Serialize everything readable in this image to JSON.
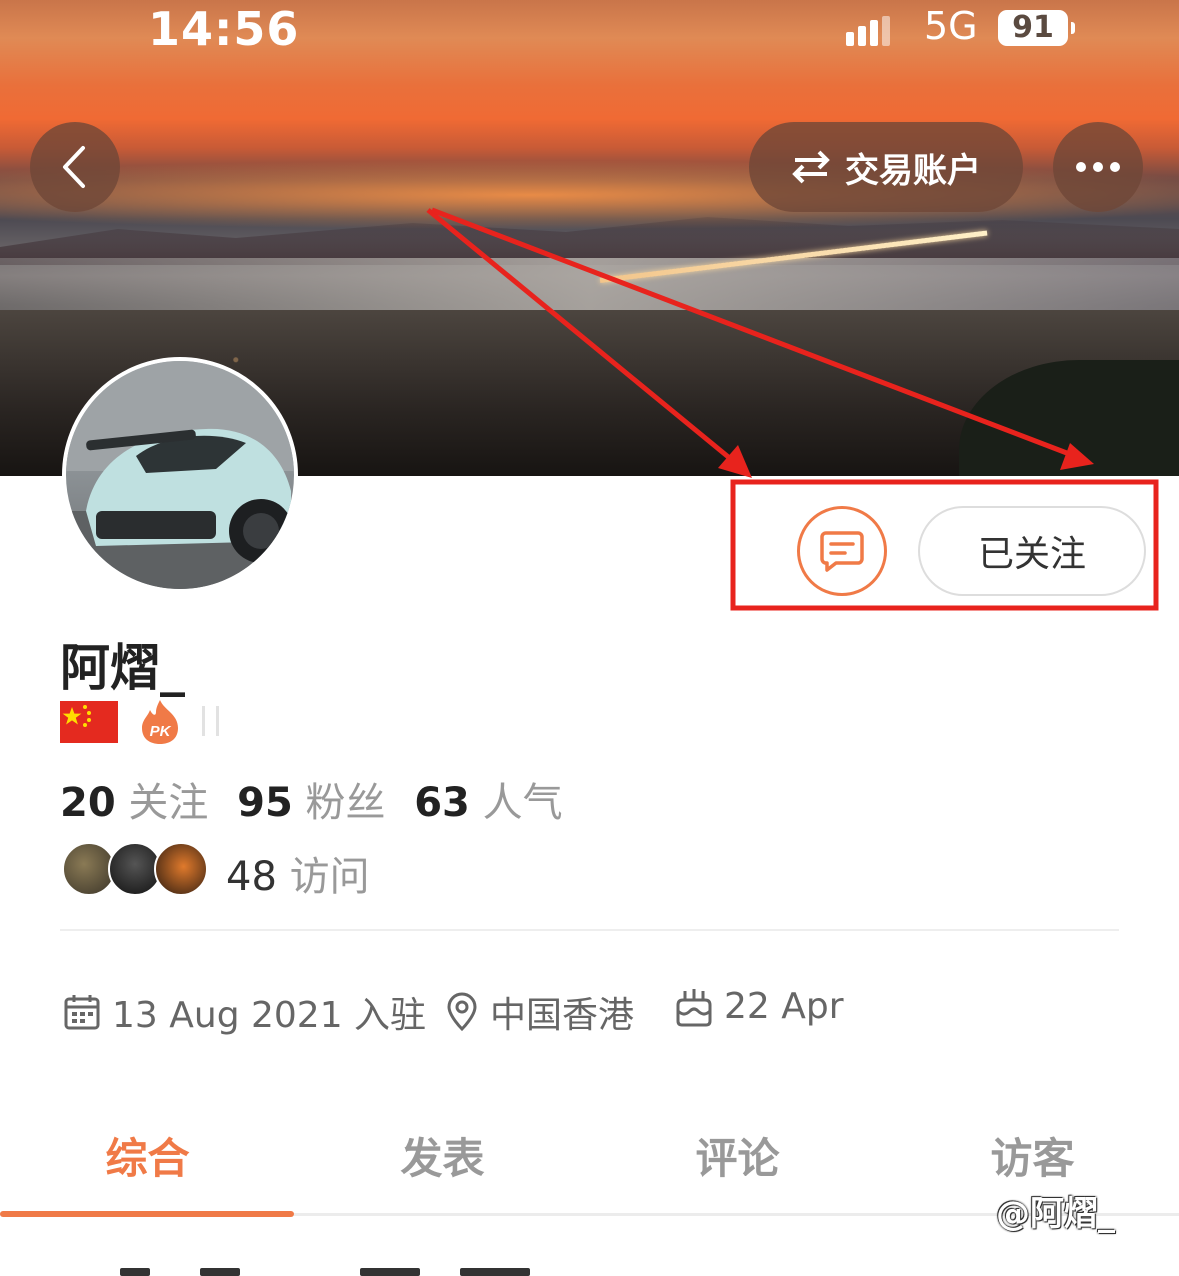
{
  "status_bar": {
    "time": "14:56",
    "network": "5G",
    "battery": "91"
  },
  "header": {
    "trade_account_label": "交易账户"
  },
  "profile": {
    "username": "阿熠_",
    "following_count": "20",
    "following_label": "关注",
    "followers_count": "95",
    "followers_label": "粉丝",
    "popularity_count": "63",
    "popularity_label": "人气",
    "visits_count": "48",
    "visits_label": "访问",
    "follow_button_label": "已关注",
    "joined": "13 Aug 2021 入驻",
    "location": "中国香港",
    "birthday": "22 Apr"
  },
  "tabs": [
    {
      "label": "综合",
      "active": true
    },
    {
      "label": "发表",
      "active": false
    },
    {
      "label": "评论",
      "active": false
    },
    {
      "label": "访客",
      "active": false
    }
  ],
  "watermark": "@阿熠_",
  "colors": {
    "accent": "#f07a47",
    "annotation": "#e8231d",
    "flag": "#e42a1f"
  },
  "icons": [
    "back-icon",
    "swap-icon",
    "more-icon",
    "message-icon",
    "calendar-icon",
    "location-icon",
    "cake-icon",
    "pk-fire-icon"
  ]
}
